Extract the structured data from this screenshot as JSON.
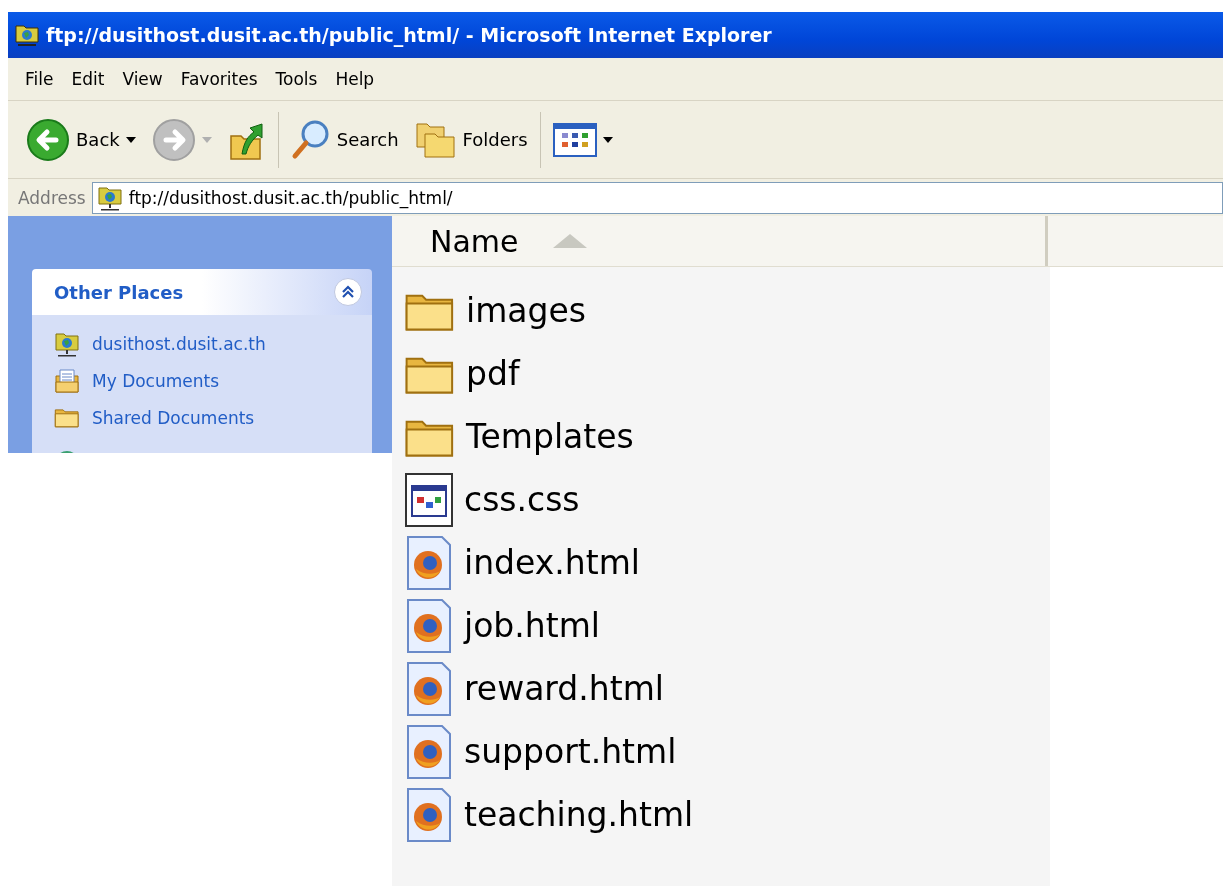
{
  "window": {
    "title": "ftp://dusithost.dusit.ac.th/public_html/ - Microsoft Internet Explorer"
  },
  "menu": [
    "File",
    "Edit",
    "View",
    "Favorites",
    "Tools",
    "Help"
  ],
  "toolbar": [
    {
      "kind": "back",
      "label": "Back",
      "disabled": false
    },
    {
      "kind": "forward",
      "disabled": true
    },
    {
      "kind": "up"
    },
    {
      "kind": "search",
      "label": "Search"
    },
    {
      "kind": "folders",
      "label": "Folders"
    },
    {
      "kind": "views"
    }
  ],
  "address": {
    "label": "Address",
    "value": "ftp://dusithost.dusit.ac.th/public_html/"
  },
  "sidebar": {
    "panel": {
      "title": "Other Places",
      "expanded": true,
      "items": [
        {
          "kind": "ftp",
          "label": "dusithost.dusit.ac.th"
        },
        {
          "kind": "documents",
          "label": "My Documents"
        },
        {
          "kind": "folder",
          "label": "Shared Documents"
        },
        {
          "kind": "network"
        }
      ]
    }
  },
  "list": {
    "columns": [
      {
        "label": "Name",
        "sorted": true
      }
    ],
    "items": [
      {
        "kind": "folder",
        "name": "images"
      },
      {
        "kind": "folder",
        "name": "pdf"
      },
      {
        "kind": "folder",
        "name": "Templates"
      },
      {
        "kind": "css",
        "name": "css.css"
      },
      {
        "kind": "html",
        "name": "index.html"
      },
      {
        "kind": "html",
        "name": "job.html"
      },
      {
        "kind": "html",
        "name": "reward.html"
      },
      {
        "kind": "html",
        "name": "support.html"
      },
      {
        "kind": "html",
        "name": "teaching.html"
      }
    ]
  }
}
